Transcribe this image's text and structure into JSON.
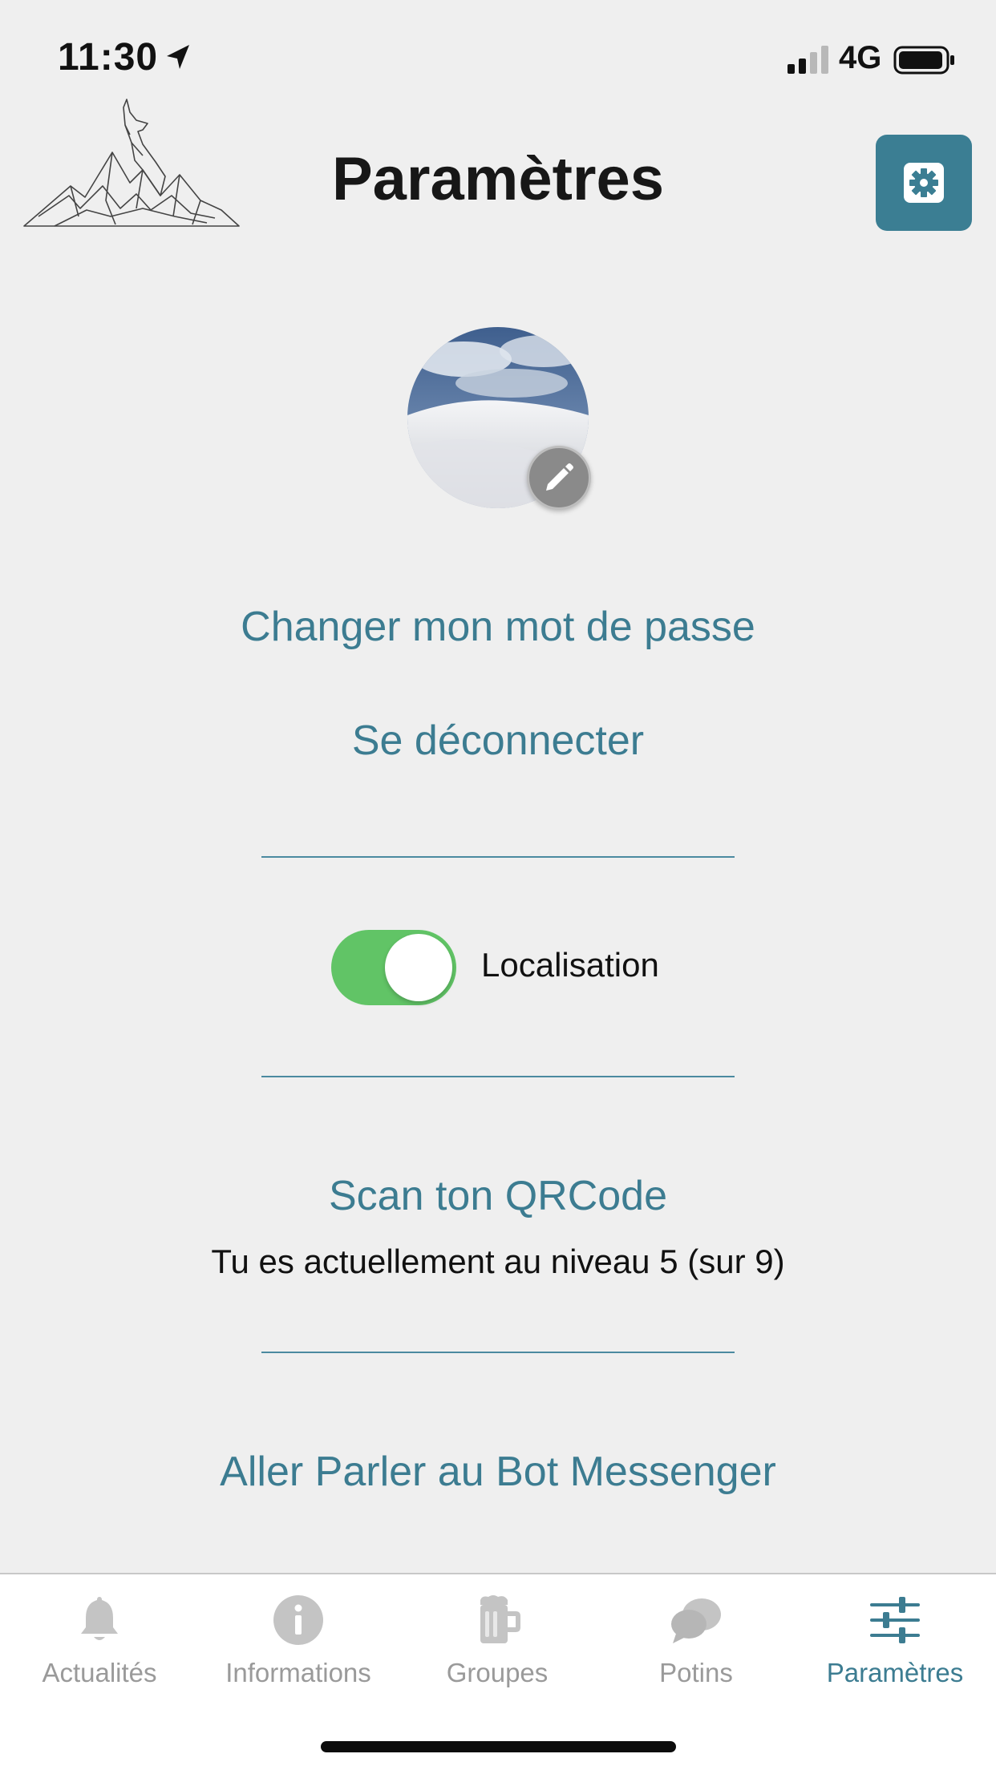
{
  "status_bar": {
    "time": "11:30",
    "network": "4G"
  },
  "header": {
    "title": "Paramètres",
    "settings_icon": "gear-icon"
  },
  "profile": {
    "avatar_icon": "snow-landscape-photo",
    "edit_icon": "pencil-icon"
  },
  "actions": {
    "change_password": "Changer mon mot de passe",
    "logout": "Se déconnecter"
  },
  "location": {
    "label": "Localisation",
    "enabled": true
  },
  "qr": {
    "scan_label": "Scan ton QRCode",
    "level_text": "Tu es actuellement au niveau 5 (sur 9)"
  },
  "bot": {
    "label": "Aller Parler au Bot Messenger"
  },
  "tab_bar": {
    "tabs": [
      {
        "label": "Actualités",
        "icon": "bell-icon"
      },
      {
        "label": "Informations",
        "icon": "info-icon"
      },
      {
        "label": "Groupes",
        "icon": "beer-mug-icon"
      },
      {
        "label": "Potins",
        "icon": "chat-bubbles-icon"
      },
      {
        "label": "Paramètres",
        "icon": "sliders-icon"
      }
    ],
    "active_index": 4
  },
  "colors": {
    "accent": "#3c7c91",
    "toggle_on": "#61c466",
    "background": "#efefef",
    "tab_inactive": "#9a9a9a"
  }
}
